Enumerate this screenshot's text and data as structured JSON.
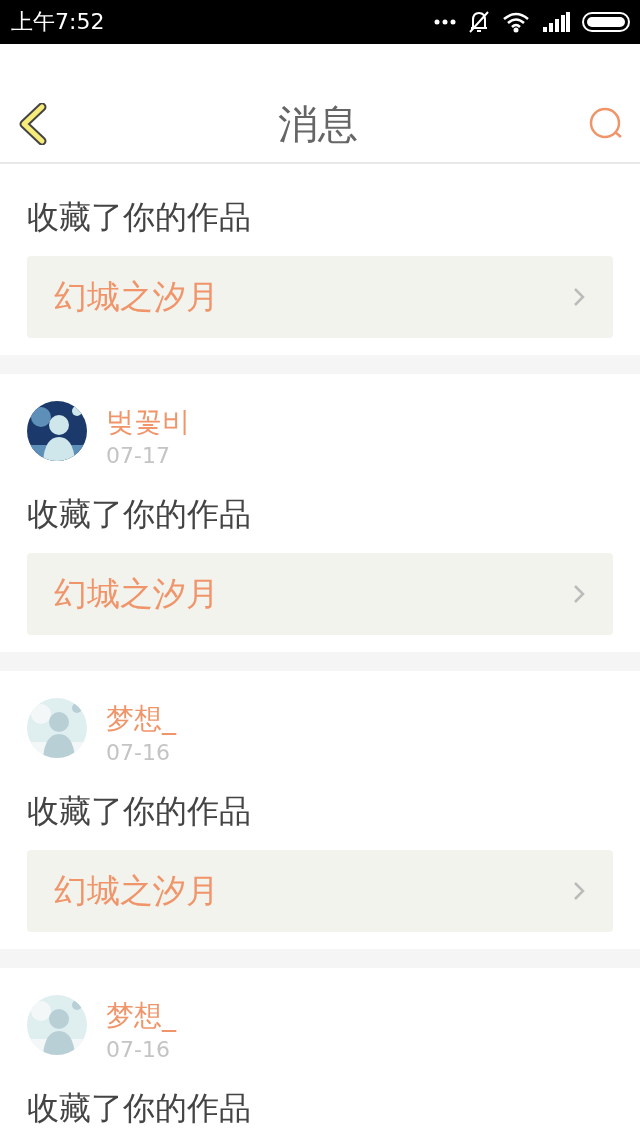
{
  "status_bar": {
    "time": "上午7:52"
  },
  "header": {
    "title": "消息"
  },
  "messages": [
    {
      "kind": "partial",
      "action": "收藏了你的作品",
      "work": "幻城之汐月"
    },
    {
      "kind": "full",
      "name": "벚꽃비",
      "date": "07-17",
      "action": "收藏了你的作品",
      "work": "幻城之汐月"
    },
    {
      "kind": "full",
      "name": "梦想_",
      "date": "07-16",
      "action": "收藏了你的作品",
      "work": "幻城之汐月"
    },
    {
      "kind": "full",
      "name": "梦想_",
      "date": "07-16",
      "action": "收藏了你的作品"
    }
  ]
}
